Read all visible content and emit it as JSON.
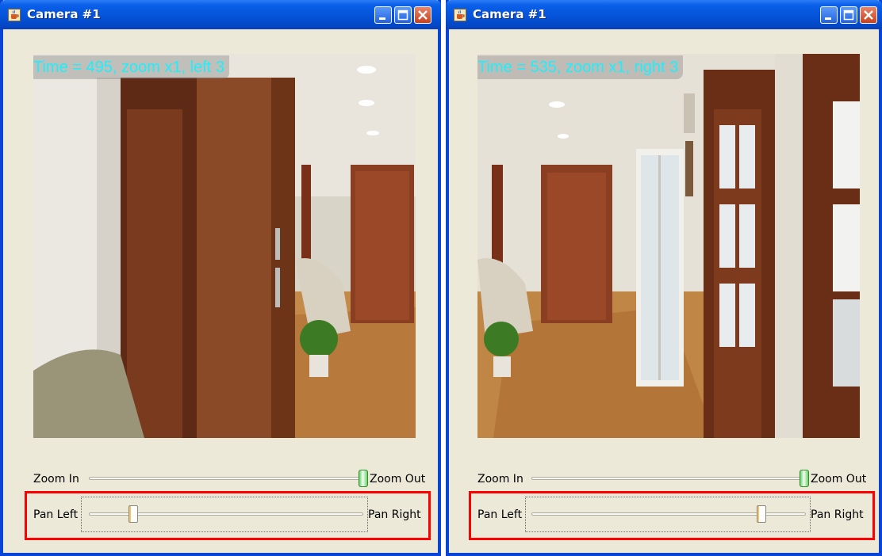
{
  "colors": {
    "accent": "#0a44d6",
    "overlay_text": "#1af0ff",
    "highlight": "#ff0000",
    "zoom_thumb": "#4bbf4b",
    "window_bg": "#ece9d8"
  },
  "windows": [
    {
      "title": "Camera #1",
      "overlay": "Time = 495, zoom x1, left 3",
      "zoom": {
        "min_label": "Zoom In",
        "max_label": "Zoom Out",
        "value_fraction": 1.0
      },
      "pan": {
        "min_label": "Pan Left",
        "max_label": "Pan Right",
        "value_fraction": 0.15
      },
      "icons": [
        "java-cup-icon",
        "minimize-icon",
        "maximize-icon",
        "close-icon"
      ]
    },
    {
      "title": "Camera #1",
      "overlay": "Time = 535, zoom x1, right 3",
      "zoom": {
        "min_label": "Zoom In",
        "max_label": "Zoom Out",
        "value_fraction": 1.0
      },
      "pan": {
        "min_label": "Pan Left",
        "max_label": "Pan Right",
        "value_fraction": 0.85
      },
      "icons": [
        "java-cup-icon",
        "minimize-icon",
        "maximize-icon",
        "close-icon"
      ]
    }
  ]
}
